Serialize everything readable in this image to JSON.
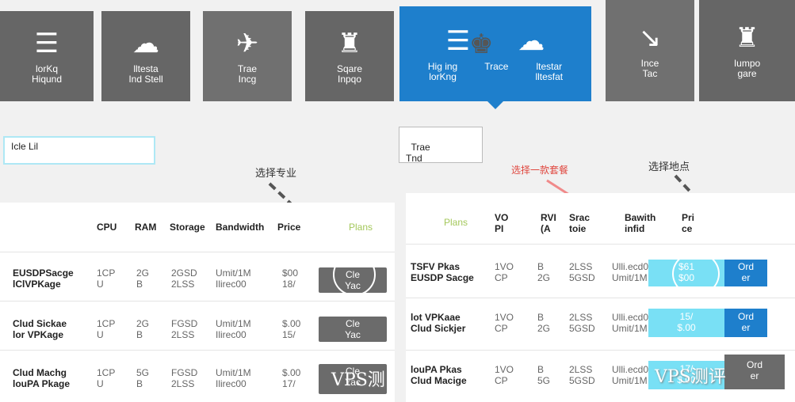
{
  "tiles": [
    {
      "glyph": "☰",
      "label": "lorKq\nHiqund"
    },
    {
      "glyph": "☁",
      "label": "lltesta\nInd Stell"
    },
    {
      "glyph": "✈",
      "label": "Trae\nIncg"
    },
    {
      "glyph": "♜",
      "label": "Sqare\nInpqo"
    },
    {
      "glyph": "☰",
      "label": "Hig ing\nlorKng"
    },
    {
      "glyph": "♚",
      "label": "Trace"
    },
    {
      "glyph": "☁",
      "label": "ltestar\nlltesfat"
    },
    {
      "glyph": "↘",
      "label": "Ince\nTac"
    },
    {
      "glyph": "♜",
      "label": "Iumpo\ngare"
    }
  ],
  "left_select": {
    "value": "Icle Lil"
  },
  "right_select": {
    "value": "Trae\nTnd"
  },
  "annotations": {
    "left": "选择专业",
    "middle": "选择一款套餐",
    "right": "选择地点"
  },
  "left_table": {
    "headers": [
      "CPU",
      "RAM",
      "Storage",
      "Bandwidth",
      "Price"
    ],
    "extra_header": "Plans",
    "rows": [
      {
        "name": "EUSDPSacge\nlClVPKage",
        "cpu": "1CP\nU",
        "ram": "2G\nB",
        "storage": "2GSD\n2LSS",
        "bandwidth": "Umit/1M\nIlirec00",
        "price": "$00\n18/",
        "button": "Cle\nYac"
      },
      {
        "name": "Clud Sickae\nlor VPKage",
        "cpu": "1CP\nU",
        "ram": "2G\nB",
        "storage": "FGSD\n2LSS",
        "bandwidth": "Umit/1M\nIlirec00",
        "price": "$.00\n15/",
        "button": "Cle\nYac"
      },
      {
        "name": "Clud Machg\nlouPA Pkage",
        "cpu": "1CP\nU",
        "ram": "5G\nB",
        "storage": "FGSD\n2LSS",
        "bandwidth": "Umit/1M\nIlirec00",
        "price": "$.00\n17/",
        "button": "Cle\nYac"
      }
    ]
  },
  "right_table": {
    "extra_header": "Plans",
    "headers": [
      "VO\nPI",
      "RVI\n(A",
      "Srac\ntoie",
      "Bawith\ninfid",
      "Pri\nce"
    ],
    "rows": [
      {
        "name": "TSFV Pkas\nEUSDP Sacge",
        "cpu": "1VO\nCP",
        "ram": "B\n2G",
        "storage": "2LSS\n5GSD",
        "bandwidth": "Ulli.ecd00\nUmit/1M",
        "price": "$61\n$00",
        "button": "Ord\ner"
      },
      {
        "name": "lot VPKaae\nClud Sickjer",
        "cpu": "1VO\nCP",
        "ram": "B\n2G",
        "storage": "2LSS\n5GSD",
        "bandwidth": "Ulli.ecd00\nUmit/1M",
        "price": "15/\n$.00",
        "button": "Ord\ner"
      },
      {
        "name": "louPA Pkas\nClud Macige",
        "cpu": "1VO\nCP",
        "ram": "B\n5G",
        "storage": "2LSS\n5GSD",
        "bandwidth": "Ulli.ecd00\nUmit/1M",
        "price": "17/\n$.00",
        "button": "Ord\ner"
      }
    ]
  },
  "watermark": {
    "left": "VPS测",
    "right": "VPS测评"
  },
  "colors": {
    "tile_grey": "#666666",
    "tile_active": "#1e7fcc",
    "accent_cyan": "#79e0f5",
    "annotation_red": "#e0473f"
  }
}
